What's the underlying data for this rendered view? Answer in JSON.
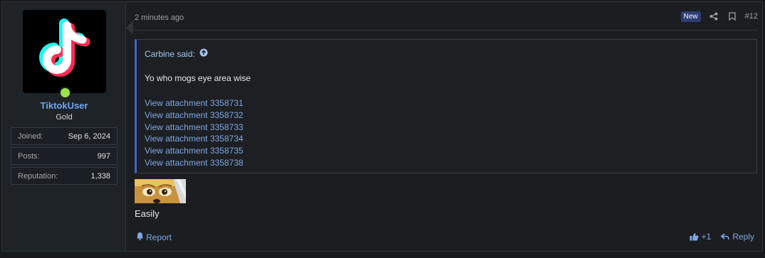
{
  "user": {
    "name": "TiktokUser",
    "title": "Gold",
    "stats": [
      {
        "label": "Joined:",
        "value": "Sep 6, 2024"
      },
      {
        "label": "Posts:",
        "value": "997"
      },
      {
        "label": "Reputation:",
        "value": "1,338"
      }
    ]
  },
  "post": {
    "time": "2 minutes ago",
    "badge": "New",
    "number": "#12",
    "quote": {
      "author": "Carbine said:",
      "text": "Yo who mogs eye area wise",
      "attachments": [
        "View attachment 3358731",
        "View attachment 3358732",
        "View attachment 3358733",
        "View attachment 3358734",
        "View attachment 3358735",
        "View attachment 3358738"
      ]
    },
    "reply": "Easily"
  },
  "actions": {
    "report": "Report",
    "like": "+1",
    "reply": "Reply"
  },
  "colors": {
    "accent": "#6ea6f0",
    "link": "#7ea7e6",
    "quote_border": "#3b66c4",
    "online": "#9be34a"
  }
}
